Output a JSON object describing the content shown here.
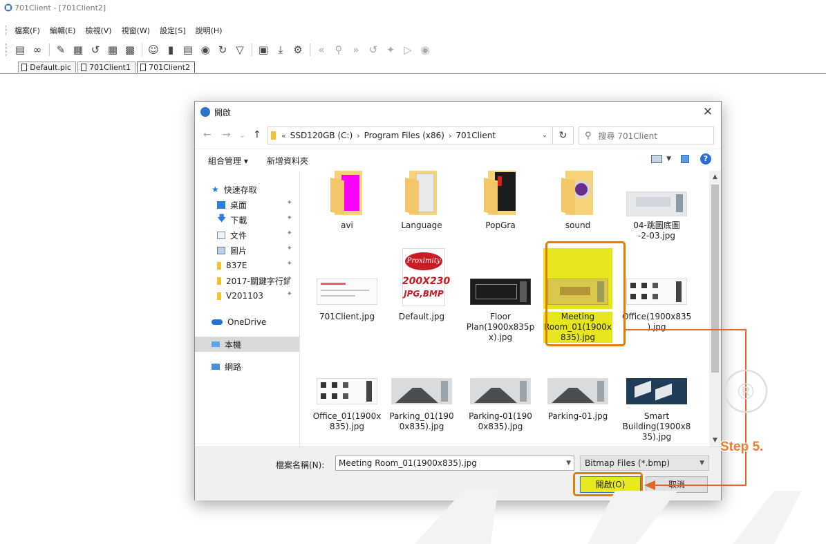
{
  "app": {
    "title": "701Client - [701Client2]",
    "menu": [
      "檔案(F)",
      "編輯(E)",
      "檢視(V)",
      "視窗(W)",
      "設定[S]",
      "說明(H)"
    ],
    "doc_tabs": [
      "Default.pic",
      "701Client1",
      "701Client2"
    ]
  },
  "dialog": {
    "title": "開啟",
    "close_glyph": "✕",
    "nav": {
      "back": "←",
      "forward": "→",
      "recent": "⌄",
      "up": "↑",
      "refresh": "↻"
    },
    "address": {
      "prefix": "«",
      "crumbs": [
        "SSD120GB (C:)",
        "Program Files (x86)",
        "701Client"
      ],
      "separator": "›",
      "dropdown": "⌄"
    },
    "search_placeholder": "搜尋 701Client",
    "commands": {
      "organize": "組合管理 ▾",
      "new_folder": "新增資料夾"
    },
    "help_glyph": "?",
    "nav_pane": [
      {
        "label": "快速存取",
        "icon": "star-icon"
      },
      {
        "label": "桌面",
        "icon": "desktop-icon",
        "pinned": true
      },
      {
        "label": "下載",
        "icon": "download-icon",
        "pinned": true
      },
      {
        "label": "文件",
        "icon": "document-icon",
        "pinned": true
      },
      {
        "label": "圖片",
        "icon": "pictures-icon",
        "pinned": true
      },
      {
        "label": "837E",
        "icon": "folder-icon",
        "pinned": true
      },
      {
        "label": "2017-關鍵字行銷",
        "icon": "folder-icon",
        "pinned": true
      },
      {
        "label": "V201103",
        "icon": "folder-icon",
        "pinned": true
      },
      {
        "label": "OneDrive",
        "icon": "cloud-icon"
      },
      {
        "label": "本機",
        "icon": "computer-icon",
        "selected": true
      },
      {
        "label": "網路",
        "icon": "network-icon"
      }
    ],
    "files": [
      {
        "label": "avi",
        "kind": "folder",
        "badge": "#ff00ff"
      },
      {
        "label": "Language",
        "kind": "folder"
      },
      {
        "label": "PopGra",
        "kind": "folder",
        "badge": "#222222"
      },
      {
        "label": "sound",
        "kind": "folder",
        "badge": "#6a2d8f"
      },
      {
        "label": "04-跳圖底圖\n-2-03.jpg",
        "kind": "image"
      },
      {
        "label": "701Client.jpg",
        "kind": "image"
      },
      {
        "label": "Default.jpg",
        "kind": "image-default",
        "thumb_text": [
          "Proximity",
          "200X230",
          "JPG,BMP"
        ]
      },
      {
        "label": "Floor\nPlan(1900x835p\nx).jpg",
        "kind": "image-dark"
      },
      {
        "label": "Meeting\nRoom_01(1900x\n835).jpg",
        "kind": "image",
        "selected": true
      },
      {
        "label": "Office(1900x835\n).jpg",
        "kind": "image"
      },
      {
        "label": "Office_01(1900x\n835).jpg",
        "kind": "image"
      },
      {
        "label": "Parking_01(190\n0x835).jpg",
        "kind": "image-road"
      },
      {
        "label": "Parking-01(190\n0x835).jpg",
        "kind": "image-road"
      },
      {
        "label": "Parking-01.jpg",
        "kind": "image-road"
      },
      {
        "label": "Smart\nBuilding(1900x8\n35).jpg",
        "kind": "image-iso"
      }
    ],
    "filename_label": "檔案名稱(N):",
    "filename_value": "Meeting Room_01(1900x835).jpg",
    "filetype": "Bitmap Files (*.bmp)",
    "open_label": "開啟(O)",
    "cancel_label": "取消"
  },
  "annotation": {
    "step_label": "Step 5.",
    "color": "#e0662a"
  },
  "watermark": {
    "symbol": "®"
  },
  "colors": {
    "highlight": "#e57b00",
    "selection": "#e9e920",
    "accent": "#2d73c8"
  }
}
